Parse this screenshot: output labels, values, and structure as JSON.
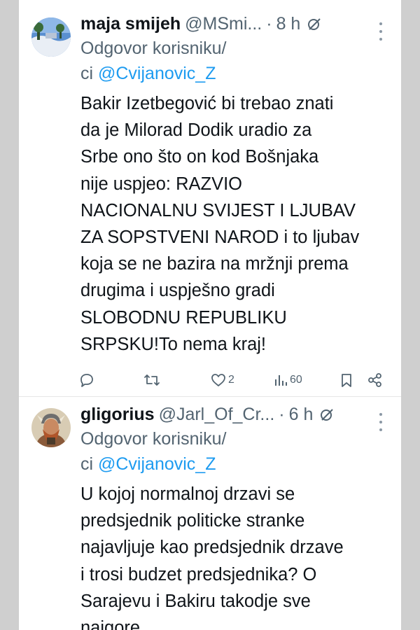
{
  "tweets": [
    {
      "name": "maja smijeh",
      "handle": "@MSmi...",
      "dot": "·",
      "time": "8 h",
      "reply_prefix": "Odgovor korisniku/",
      "reply_ci": "ci ",
      "reply_mention": "@Cvijanovic_Z",
      "body": "Bakir Izetbegović bi trebao znati\nda je Milorad Dodik uradio za\nSrbe ono što on kod Bošnjaka\nnije uspjeo: RAZVIO\nNACIONALNU SVIJEST I LJUBAV\nZA SOPSTVENI NAROD i to ljubav\nkoja se ne bazira na mržnji prema\ndrugima i uspješno gradi\nSLOBODNU REPUBLIKU\nSRPSKU!To nema kraj!",
      "likes": "2",
      "views": "60",
      "icons": [
        "reply-icon",
        "retweet-icon",
        "like-icon",
        "views-icon",
        "bookmark-icon",
        "share-icon"
      ]
    },
    {
      "name": "gligorius",
      "handle": "@Jarl_Of_Cr...",
      "dot": "·",
      "time": "6 h",
      "reply_prefix": "Odgovor korisniku/",
      "reply_ci": "ci ",
      "reply_mention": "@Cvijanovic_Z",
      "body": "U kojoj normalnoj drzavi se\npredsjednik politicke stranke\nnajavljuje kao predsjednik drzave\ni trosi budzet predsjednika? O\nSarajevu i Bakiru takodje sve\nnajgore"
    }
  ],
  "colors": {
    "accent": "#1d9bf0",
    "secondary_text": "#536471",
    "primary_text": "#0f1419",
    "background": "#ffffff",
    "outer_frame": "#cfcfcf"
  }
}
